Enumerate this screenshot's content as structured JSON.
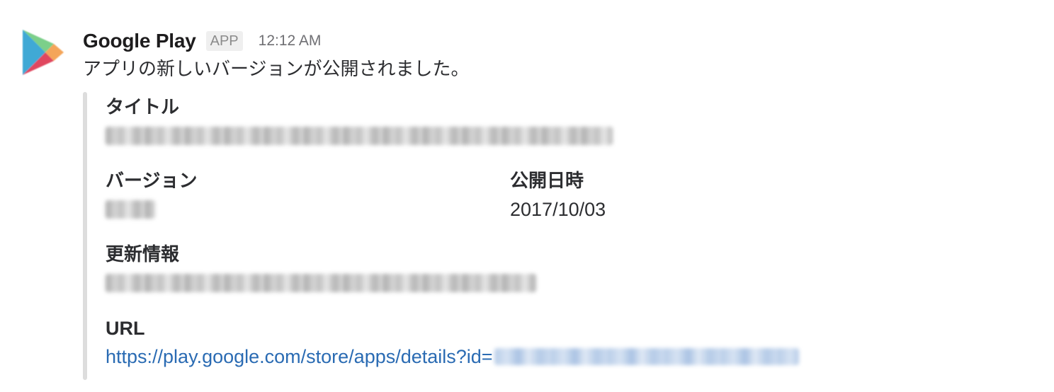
{
  "sender": {
    "name": "Google Play",
    "badge": "APP",
    "timestamp": "12:12 AM",
    "icon": "google-play-icon"
  },
  "message": {
    "text": "アプリの新しいバージョンが公開されました。"
  },
  "attachment": {
    "fields": {
      "title": {
        "label": "タイトル",
        "value": ""
      },
      "version": {
        "label": "バージョン",
        "value": ""
      },
      "published": {
        "label": "公開日時",
        "value": "2017/10/03"
      },
      "changelog": {
        "label": "更新情報",
        "value": ""
      },
      "url": {
        "label": "URL",
        "value": "https://play.google.com/store/apps/details?id="
      }
    }
  },
  "colors": {
    "link": "#2a6bb3",
    "attachment_border": "#dddddd",
    "badge_bg": "#efefef",
    "badge_text": "#8b8b8b"
  }
}
